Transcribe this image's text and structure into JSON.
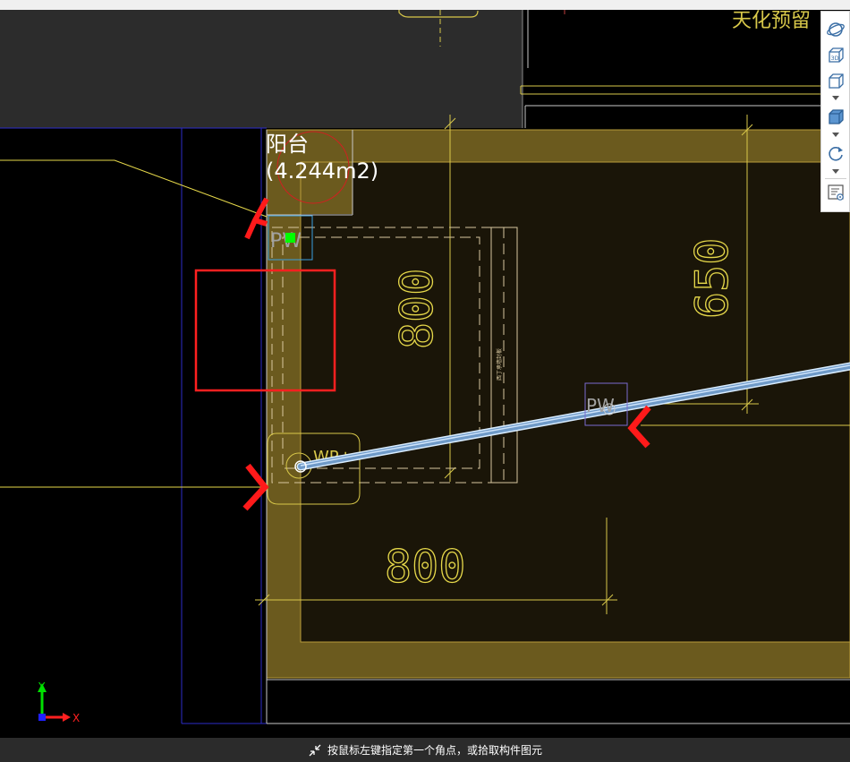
{
  "canvas": {
    "room_label_name": "阳台",
    "room_label_area": "(4.244m2)",
    "top_right_text": "天化预留",
    "dim_800_vertical": "800",
    "dim_650": "650",
    "dim_800_horizontal": "800",
    "tag_pw_1": "PW",
    "tag_pw_2": "PW",
    "tag_wp": "WP+",
    "small_note": "西丁承墙封板",
    "axis_y": "Y",
    "axis_x": "X"
  },
  "toolbar": {
    "items": [
      "orbit-icon",
      "view-3d-icon",
      "view-cube-icon",
      "shaded-cube-icon",
      "rotate-icon",
      "view-settings-icon"
    ]
  },
  "status": {
    "prompt": "按鼠标左键指定第一个角点，或拾取构件图元"
  },
  "colors": {
    "background": "#000000",
    "panel_gray": "#2c2c2c",
    "slab_fill": "#6b5a1e",
    "inner_fill": "#1a1508",
    "cad_yellow": "#d8c84a",
    "pipe_blue": "#a6c8e6",
    "highlight_red": "#ff2020",
    "accent_green": "#00ff00",
    "outline_blue": "#2c2cc8"
  }
}
